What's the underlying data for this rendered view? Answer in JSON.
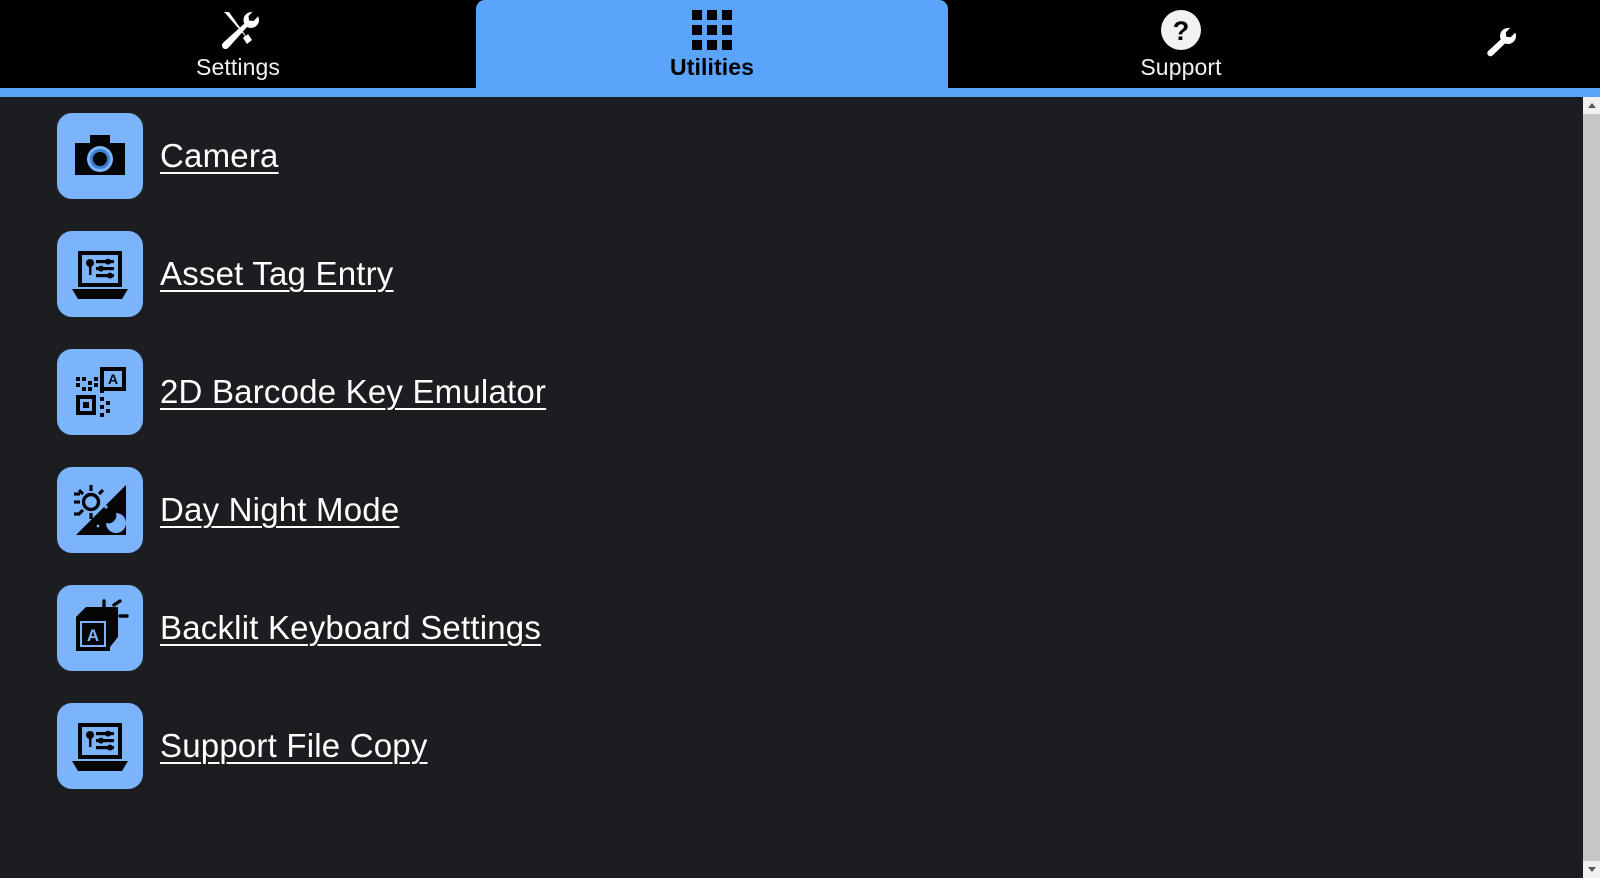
{
  "colors": {
    "accent": "#5aa5fb",
    "tile": "#7cb4fc",
    "tabbar_bg": "#000000",
    "content_bg": "#1b1d21",
    "text": "#ffffff"
  },
  "tabs": [
    {
      "id": "settings",
      "label": "Settings",
      "icon": "tools-icon",
      "active": false
    },
    {
      "id": "utilities",
      "label": "Utilities",
      "icon": "grid-icon",
      "active": true
    },
    {
      "id": "support",
      "label": "Support",
      "icon": "question-mark-icon",
      "active": false
    }
  ],
  "topbar": {
    "wrench_icon": "wrench-icon"
  },
  "utilities": {
    "items": [
      {
        "label": "Camera",
        "icon": "camera-icon"
      },
      {
        "label": "Asset Tag Entry",
        "icon": "laptop-settings-icon"
      },
      {
        "label": "2D Barcode Key Emulator",
        "icon": "qr-key-icon"
      },
      {
        "label": "Day Night Mode",
        "icon": "sun-moon-icon"
      },
      {
        "label": "Backlit Keyboard Settings",
        "icon": "backlit-key-icon"
      },
      {
        "label": "Support File Copy",
        "icon": "laptop-settings-icon"
      }
    ]
  },
  "scrollbar": {
    "up_arrow": "scroll-up-arrow",
    "down_arrow": "scroll-down-arrow"
  }
}
